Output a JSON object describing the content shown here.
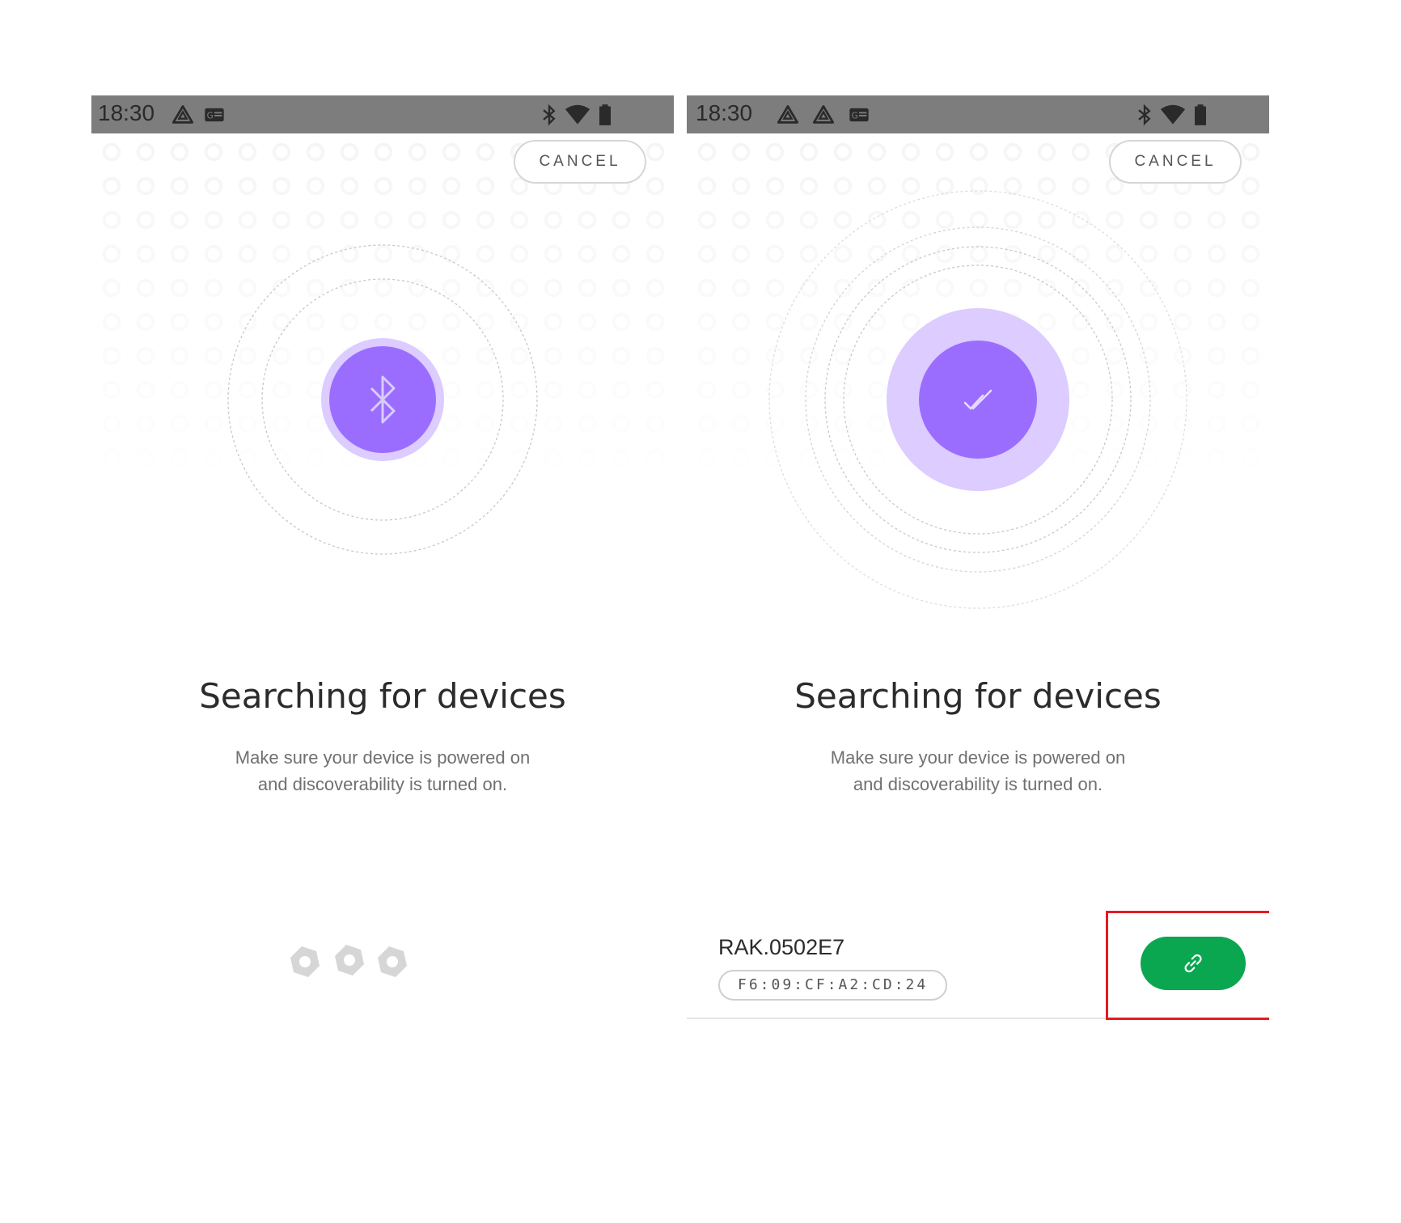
{
  "colors": {
    "statusbar_bg": "#7d7d7d",
    "accent_purple": "#9b6dff",
    "halo_purple": "#dcccff",
    "connect_green": "#0aa650",
    "highlight_red": "#e51b23"
  },
  "left_screen": {
    "statusbar": {
      "time": "18:30",
      "left_icons": [
        "drive-icon",
        "news-icon"
      ],
      "right_icons": [
        "bluetooth-icon",
        "wifi-icon",
        "battery-icon"
      ]
    },
    "cancel_label": "CANCEL",
    "center_icon": "bluetooth-icon",
    "title": "Searching for devices",
    "subtitle_line1": "Make sure your device is powered on",
    "subtitle_line2": "and discoverability is turned on.",
    "loader_icons": [
      "hexagon-icon",
      "hexagon-icon",
      "hexagon-icon"
    ]
  },
  "right_screen": {
    "statusbar": {
      "time": "18:30",
      "left_icons": [
        "drive-icon",
        "drive-icon",
        "news-icon"
      ],
      "right_icons": [
        "bluetooth-icon",
        "wifi-icon",
        "battery-icon"
      ]
    },
    "cancel_label": "CANCEL",
    "center_icon": "double-check-icon",
    "title": "Searching for devices",
    "subtitle_line1": "Make sure your device is powered on",
    "subtitle_line2": "and discoverability is turned on.",
    "device": {
      "name": "RAK.0502E7",
      "mac": "F6:09:CF:A2:CD:24",
      "connect_icon": "link-icon"
    }
  }
}
